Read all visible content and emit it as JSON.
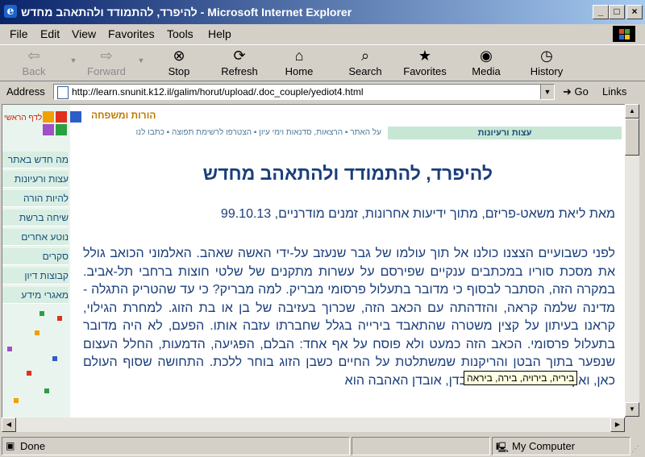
{
  "window": {
    "title": "להיפרד, להתמודד ולהתאהב מחדש - Microsoft Internet Explorer",
    "controls": [
      "_",
      "□",
      "×"
    ]
  },
  "menu": {
    "items": [
      {
        "label": "File",
        "mnemonic": "F"
      },
      {
        "label": "Edit",
        "mnemonic": "E"
      },
      {
        "label": "View",
        "mnemonic": "V"
      },
      {
        "label": "Favorites",
        "mnemonic": "a"
      },
      {
        "label": "Tools",
        "mnemonic": "T"
      },
      {
        "label": "Help",
        "mnemonic": "H"
      }
    ]
  },
  "toolbar": {
    "back": "Back",
    "forward": "Forward",
    "stop": "Stop",
    "refresh": "Refresh",
    "home": "Home",
    "search": "Search",
    "favorites": "Favorites",
    "media": "Media",
    "history": "History"
  },
  "address": {
    "label": "Address",
    "url": "http://learn.snunit.k12.il/galim/horut/upload/.doc_couple/yediot4.html",
    "go": "Go",
    "links": "Links"
  },
  "page": {
    "logo_text": "לדף הראשי",
    "section_title": "הורות ומשפחה",
    "tips_tab": "עצות ורעיונות",
    "top_links": [
      "על האתר",
      "הרצאות, סדנאות וימי עיון",
      "הצטרפו לרשימת תפוצה",
      "כתבו לנו"
    ],
    "nav": [
      "מה חדש באתר",
      "עצות ורעיונות",
      "להיות הורה",
      "שיחה ברשת",
      "נוטע אחרים",
      "סקרים",
      "קבוצות דיון",
      "מאגרי מידע"
    ],
    "headline": "להיפרד, להתמודד ולהתאהב מחדש",
    "byline": "מאת ליאת משאט-פריזם, מתוך ידיעות אחרונות, זמנים מודרניים, 99.10.13",
    "paragraph": "לפני כשבועיים הצצנו כולנו אל תוך עולמו של גבר שנעזב על-ידי האשה שאהב. האלמוני הכואב גולל את מסכת סוריו במכתבים ענקיים שפירסם על עשרות מתקנים של שלטי חוצות ברחבי תל-אביב. במקרה הזה, הסתבר לבסוף כי מדובר בתעלול פרסומי מבריק. למה מבריק? כי עד שהטריק התגלה - מדינה שלמה קראה, והזדהתה עם הכאב הזה, שכרוך בעזיבה של בן או בת הזוג. למחרת הגילוי, קראנו בעיתון על קצין משטרה שהתאבד בירייה בגלל שחברתו עזבה אותו. הפעם, לא היה מדובר בתעלול פרסומי. הכאב הזה כמעט ולא פוסח על אף אחד: הבלם, הפגיעה, הדמעות, החלל העצום שנפער בתוך הבטן והריקנות שמשתלטת על החיים כשבן הזוג בוחר ללכת. התחושה שסוף העולם כאן, ואין מחר. מכל סוגי האובדן, אובדן האהבה הוא",
    "tooltip": "ביריה, בירויה, בירה, ביראה"
  },
  "status": {
    "text": "Done",
    "zone": "My Computer"
  },
  "colors": {
    "title_start": "#0a246a",
    "title_end": "#a6caf0",
    "chrome": "#d4d0c8",
    "page_text": "#1a3e7a",
    "nav_bg": "#d8eee3"
  }
}
